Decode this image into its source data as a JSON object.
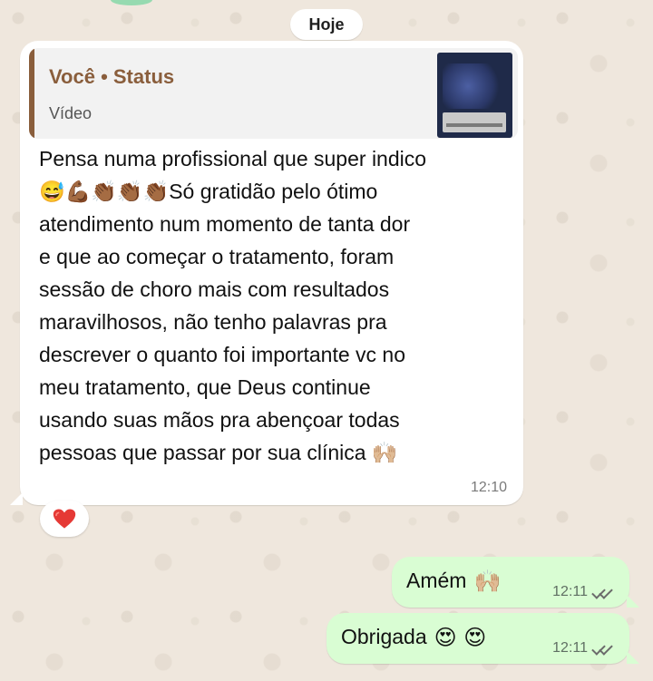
{
  "chat": {
    "date_chip": "Hoje"
  },
  "incoming_message": {
    "quote": {
      "author": "Você • Status",
      "kind": "Vídeo"
    },
    "text": "Pensa numa profissional que super indico\n😅💪🏾👏🏾👏🏾👏🏾Só gratidão pelo ótimo\natendimento num momento de tanta dor\ne que ao começar o tratamento, foram\nsessão de choro mais com resultados\nmaravilhosos, não tenho palavras pra\ndescrever o quanto foi importante vc no\nmeu tratamento, que Deus continue\nusando suas mãos pra abençoar todas\npessoas que passar por sua clínica 🙌🏼",
    "time": "12:10",
    "reaction": "❤️"
  },
  "outgoing_messages": [
    {
      "text": "Amém",
      "emoji": "🙌🏼",
      "time": "12:11"
    },
    {
      "text": "Obrigada",
      "emoji": "😍 😍",
      "time": "12:11"
    }
  ],
  "colors": {
    "incoming_bubble": "#ffffff",
    "outgoing_bubble": "#d9fdd3",
    "quote_accent": "#8a5e3c",
    "wallpaper": "#efe7dd",
    "reaction_heart": "#e53935"
  },
  "icons": {
    "read_receipt": "double-check-icon",
    "reaction": "heart-icon"
  }
}
